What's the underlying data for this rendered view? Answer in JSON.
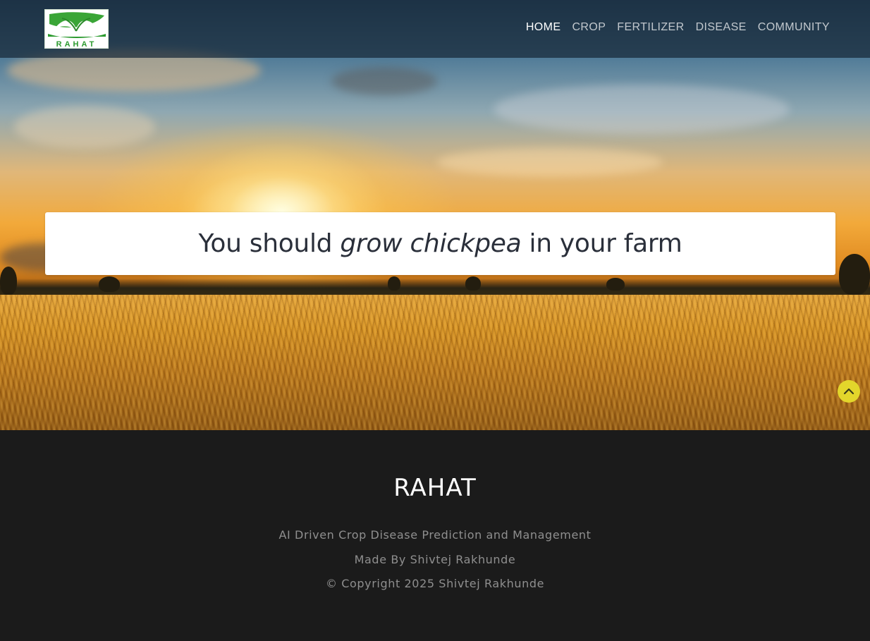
{
  "logo": {
    "text": "RAHAT",
    "accent_color": "#2b9a2e"
  },
  "nav": {
    "items": [
      {
        "label": "HOME",
        "active": true
      },
      {
        "label": "CROP",
        "active": false
      },
      {
        "label": "FERTILIZER",
        "active": false
      },
      {
        "label": "DISEASE",
        "active": false
      },
      {
        "label": "COMMUNITY",
        "active": false
      }
    ]
  },
  "result": {
    "prefix": "You should",
    "verb": "grow",
    "crop": "chickpea",
    "suffix": "in your farm"
  },
  "scroll_top": {
    "icon": "chevron-up-icon",
    "color": "#e3d62b"
  },
  "footer": {
    "title": "RAHAT",
    "tagline": "AI Driven Crop Disease Prediction and Management",
    "made_by": "Made By Shivtej Rakhunde",
    "copyright": "© Copyright 2025 Shivtej Rakhunde",
    "background": "#1b1b1b"
  }
}
